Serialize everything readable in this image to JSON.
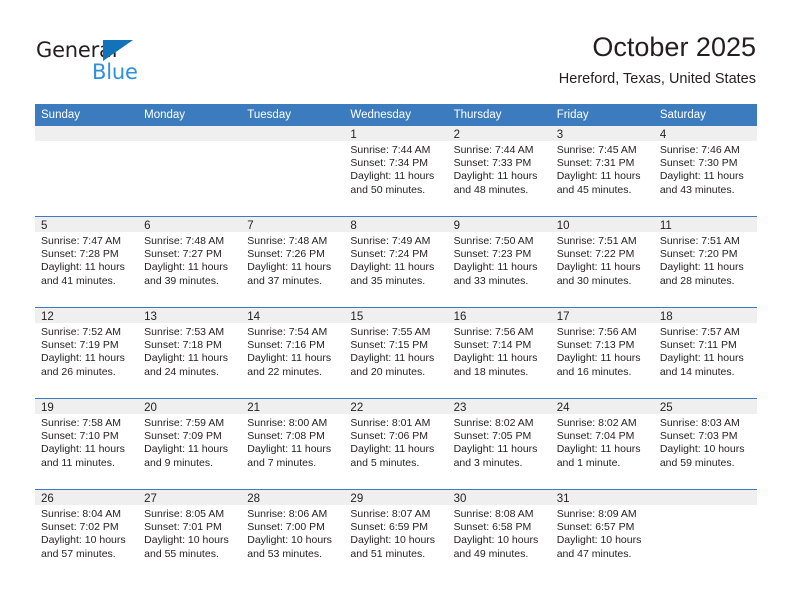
{
  "brand": {
    "logo_text_top": "General",
    "logo_text_bottom": "Blue",
    "logo_triangle_icon": "triangle-icon",
    "accent_color": "#1273BA",
    "accent_color_light": "#2E90DE"
  },
  "header": {
    "month_title": "October 2025",
    "location": "Hereford, Texas, United States"
  },
  "colors": {
    "header_row_bg": "#3C7CBE",
    "date_strip_bg": "#EFEFEF",
    "text": "#231F20",
    "row_divider": "#3C7CBE"
  },
  "weekday_headers": [
    "Sunday",
    "Monday",
    "Tuesday",
    "Wednesday",
    "Thursday",
    "Friday",
    "Saturday"
  ],
  "weeks": [
    [
      {
        "date": "",
        "blank": true,
        "sunrise": "",
        "sunset": "",
        "daylight": ""
      },
      {
        "date": "",
        "blank": true,
        "sunrise": "",
        "sunset": "",
        "daylight": ""
      },
      {
        "date": "",
        "blank": true,
        "sunrise": "",
        "sunset": "",
        "daylight": ""
      },
      {
        "date": "1",
        "sunrise": "Sunrise: 7:44 AM",
        "sunset": "Sunset: 7:34 PM",
        "daylight": "Daylight: 11 hours and 50 minutes."
      },
      {
        "date": "2",
        "sunrise": "Sunrise: 7:44 AM",
        "sunset": "Sunset: 7:33 PM",
        "daylight": "Daylight: 11 hours and 48 minutes."
      },
      {
        "date": "3",
        "sunrise": "Sunrise: 7:45 AM",
        "sunset": "Sunset: 7:31 PM",
        "daylight": "Daylight: 11 hours and 45 minutes."
      },
      {
        "date": "4",
        "sunrise": "Sunrise: 7:46 AM",
        "sunset": "Sunset: 7:30 PM",
        "daylight": "Daylight: 11 hours and 43 minutes."
      }
    ],
    [
      {
        "date": "5",
        "sunrise": "Sunrise: 7:47 AM",
        "sunset": "Sunset: 7:28 PM",
        "daylight": "Daylight: 11 hours and 41 minutes."
      },
      {
        "date": "6",
        "sunrise": "Sunrise: 7:48 AM",
        "sunset": "Sunset: 7:27 PM",
        "daylight": "Daylight: 11 hours and 39 minutes."
      },
      {
        "date": "7",
        "sunrise": "Sunrise: 7:48 AM",
        "sunset": "Sunset: 7:26 PM",
        "daylight": "Daylight: 11 hours and 37 minutes."
      },
      {
        "date": "8",
        "sunrise": "Sunrise: 7:49 AM",
        "sunset": "Sunset: 7:24 PM",
        "daylight": "Daylight: 11 hours and 35 minutes."
      },
      {
        "date": "9",
        "sunrise": "Sunrise: 7:50 AM",
        "sunset": "Sunset: 7:23 PM",
        "daylight": "Daylight: 11 hours and 33 minutes."
      },
      {
        "date": "10",
        "sunrise": "Sunrise: 7:51 AM",
        "sunset": "Sunset: 7:22 PM",
        "daylight": "Daylight: 11 hours and 30 minutes."
      },
      {
        "date": "11",
        "sunrise": "Sunrise: 7:51 AM",
        "sunset": "Sunset: 7:20 PM",
        "daylight": "Daylight: 11 hours and 28 minutes."
      }
    ],
    [
      {
        "date": "12",
        "sunrise": "Sunrise: 7:52 AM",
        "sunset": "Sunset: 7:19 PM",
        "daylight": "Daylight: 11 hours and 26 minutes."
      },
      {
        "date": "13",
        "sunrise": "Sunrise: 7:53 AM",
        "sunset": "Sunset: 7:18 PM",
        "daylight": "Daylight: 11 hours and 24 minutes."
      },
      {
        "date": "14",
        "sunrise": "Sunrise: 7:54 AM",
        "sunset": "Sunset: 7:16 PM",
        "daylight": "Daylight: 11 hours and 22 minutes."
      },
      {
        "date": "15",
        "sunrise": "Sunrise: 7:55 AM",
        "sunset": "Sunset: 7:15 PM",
        "daylight": "Daylight: 11 hours and 20 minutes."
      },
      {
        "date": "16",
        "sunrise": "Sunrise: 7:56 AM",
        "sunset": "Sunset: 7:14 PM",
        "daylight": "Daylight: 11 hours and 18 minutes."
      },
      {
        "date": "17",
        "sunrise": "Sunrise: 7:56 AM",
        "sunset": "Sunset: 7:13 PM",
        "daylight": "Daylight: 11 hours and 16 minutes."
      },
      {
        "date": "18",
        "sunrise": "Sunrise: 7:57 AM",
        "sunset": "Sunset: 7:11 PM",
        "daylight": "Daylight: 11 hours and 14 minutes."
      }
    ],
    [
      {
        "date": "19",
        "sunrise": "Sunrise: 7:58 AM",
        "sunset": "Sunset: 7:10 PM",
        "daylight": "Daylight: 11 hours and 11 minutes."
      },
      {
        "date": "20",
        "sunrise": "Sunrise: 7:59 AM",
        "sunset": "Sunset: 7:09 PM",
        "daylight": "Daylight: 11 hours and 9 minutes."
      },
      {
        "date": "21",
        "sunrise": "Sunrise: 8:00 AM",
        "sunset": "Sunset: 7:08 PM",
        "daylight": "Daylight: 11 hours and 7 minutes."
      },
      {
        "date": "22",
        "sunrise": "Sunrise: 8:01 AM",
        "sunset": "Sunset: 7:06 PM",
        "daylight": "Daylight: 11 hours and 5 minutes."
      },
      {
        "date": "23",
        "sunrise": "Sunrise: 8:02 AM",
        "sunset": "Sunset: 7:05 PM",
        "daylight": "Daylight: 11 hours and 3 minutes."
      },
      {
        "date": "24",
        "sunrise": "Sunrise: 8:02 AM",
        "sunset": "Sunset: 7:04 PM",
        "daylight": "Daylight: 11 hours and 1 minute."
      },
      {
        "date": "25",
        "sunrise": "Sunrise: 8:03 AM",
        "sunset": "Sunset: 7:03 PM",
        "daylight": "Daylight: 10 hours and 59 minutes."
      }
    ],
    [
      {
        "date": "26",
        "sunrise": "Sunrise: 8:04 AM",
        "sunset": "Sunset: 7:02 PM",
        "daylight": "Daylight: 10 hours and 57 minutes."
      },
      {
        "date": "27",
        "sunrise": "Sunrise: 8:05 AM",
        "sunset": "Sunset: 7:01 PM",
        "daylight": "Daylight: 10 hours and 55 minutes."
      },
      {
        "date": "28",
        "sunrise": "Sunrise: 8:06 AM",
        "sunset": "Sunset: 7:00 PM",
        "daylight": "Daylight: 10 hours and 53 minutes."
      },
      {
        "date": "29",
        "sunrise": "Sunrise: 8:07 AM",
        "sunset": "Sunset: 6:59 PM",
        "daylight": "Daylight: 10 hours and 51 minutes."
      },
      {
        "date": "30",
        "sunrise": "Sunrise: 8:08 AM",
        "sunset": "Sunset: 6:58 PM",
        "daylight": "Daylight: 10 hours and 49 minutes."
      },
      {
        "date": "31",
        "sunrise": "Sunrise: 8:09 AM",
        "sunset": "Sunset: 6:57 PM",
        "daylight": "Daylight: 10 hours and 47 minutes."
      },
      {
        "date": "",
        "blank": true,
        "sunrise": "",
        "sunset": "",
        "daylight": ""
      }
    ]
  ]
}
